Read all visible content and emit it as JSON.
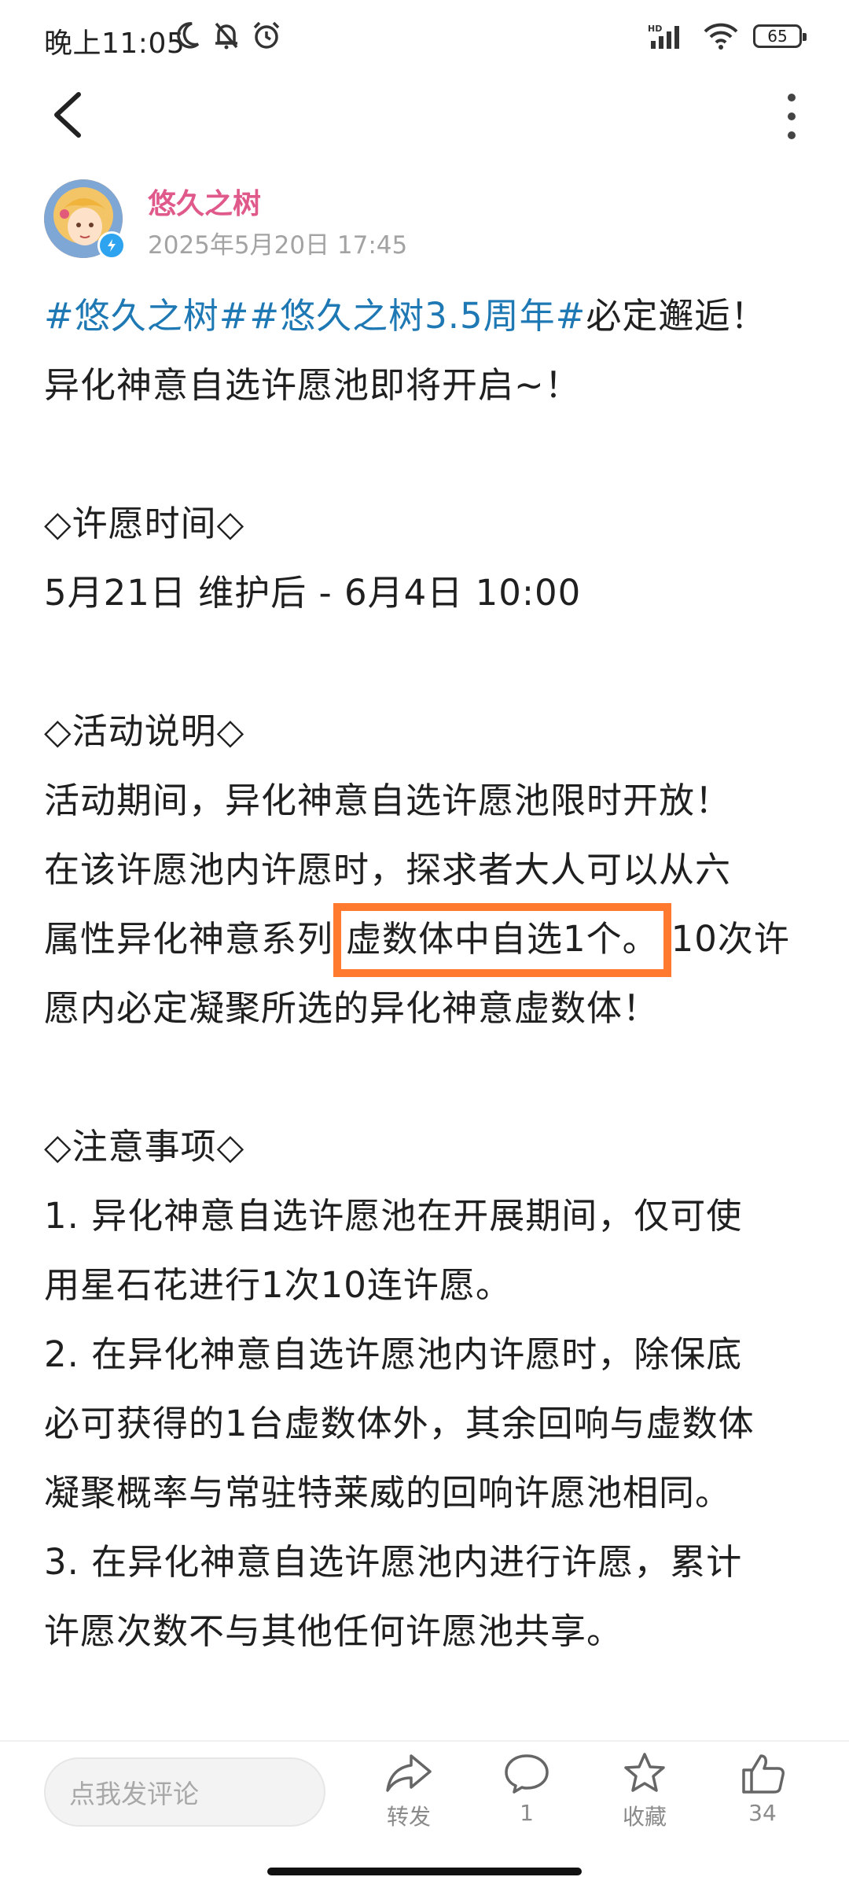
{
  "status_bar": {
    "time": "晚上11:05",
    "battery": "65",
    "icons": [
      "moon-icon",
      "mute-bell-icon",
      "alarm-icon",
      "hd-signal-icon",
      "wifi-icon",
      "battery-icon"
    ]
  },
  "nav": {
    "back_icon": "back-chevron-icon",
    "more_icon": "more-vertical-icon"
  },
  "post": {
    "author": "悠久之树",
    "time": "2025年5月20日 17:45",
    "lines": {
      "l1_tag": "#悠久之树##悠久之树3.5周年#",
      "l1_rest": "必定邂逅！",
      "l2": "异化神意自选许愿池即将开启~！",
      "l3": "◇许愿时间◇",
      "l4": "5月21日 维护后 - 6月4日 10:00",
      "l5": "◇活动说明◇",
      "l6": "活动期间，异化神意自选许愿池限时开放！",
      "l7": "在该许愿池内许愿时，探求者大人可以从六",
      "l8_pre": "属性异化神意系列",
      "l8_highlight": "虚数体中自选1个。",
      "l8_post": "10次许",
      "l9": "愿内必定凝聚所选的异化神意虚数体！",
      "l10": "◇注意事项◇",
      "l11": "1. 异化神意自选许愿池在开展期间，仅可使",
      "l12": "用星石花进行1次10连许愿。",
      "l13": "2. 在异化神意自选许愿池内许愿时，除保底",
      "l14": "必可获得的1台虚数体外，其余回响与虚数体",
      "l15": "凝聚概率与常驻特莱威的回响许愿池相同。",
      "l16": "3. 在异化神意自选许愿池内进行许愿，累计",
      "l17": "许愿次数不与其他任何许愿池共享。"
    },
    "highlight_color": "#ff7a2f",
    "tag_color": "#1e78b4",
    "author_color": "#e0598b"
  },
  "bottom_bar": {
    "comment_placeholder": "点我发评论",
    "share_label": "转发",
    "comment_count": "1",
    "favorite_label": "收藏",
    "like_count": "34"
  }
}
